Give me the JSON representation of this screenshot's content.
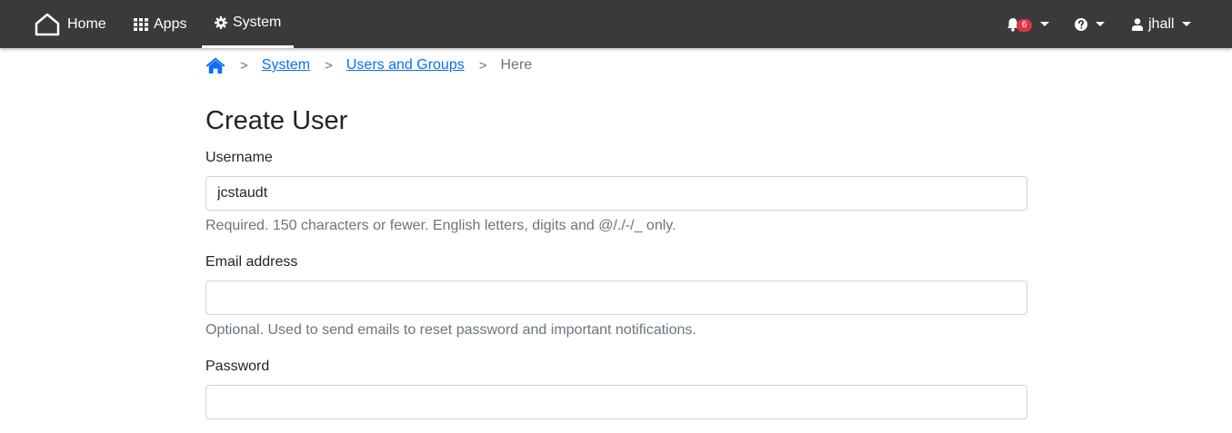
{
  "navbar": {
    "home_label": "Home",
    "apps_label": "Apps",
    "system_label": "System",
    "notification_count": "6",
    "user_label": "jhall",
    "icons": {
      "home": "home-outline-icon",
      "apps": "grid-icon",
      "system": "gear-icon",
      "notifications": "bell-icon",
      "help": "question-circle-icon",
      "user": "user-icon"
    }
  },
  "breadcrumb": {
    "items": [
      {
        "label": "System"
      },
      {
        "label": "Users and Groups"
      }
    ],
    "current": "Here",
    "separator": ">"
  },
  "form": {
    "title": "Create User",
    "username": {
      "label": "Username",
      "value": "jcstaudt",
      "help": "Required. 150 characters or fewer. English letters, digits and @/./-/_ only."
    },
    "email": {
      "label": "Email address",
      "value": "",
      "help": "Optional. Used to send emails to reset password and important notifications."
    },
    "password": {
      "label": "Password",
      "value": ""
    }
  },
  "colors": {
    "navbar_bg": "#3a3a3a",
    "link": "#0d6efd",
    "badge": "#dc3545",
    "muted": "#6c757d"
  }
}
